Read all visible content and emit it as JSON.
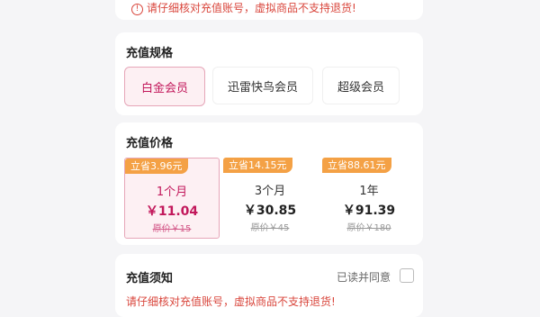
{
  "top_notice": "请仔细核对充值账号，虚拟商品不支持退货!",
  "spec": {
    "title": "充值规格",
    "options": [
      "白金会员",
      "迅雷快鸟会员",
      "超级会员"
    ],
    "selected": 0
  },
  "price": {
    "title": "充值价格",
    "plans": [
      {
        "save": "立省3.96元",
        "duration": "1个月",
        "price": "￥11.04",
        "original": "原价￥15"
      },
      {
        "save": "立省14.15元",
        "duration": "3个月",
        "price": "￥30.85",
        "original": "原价￥45"
      },
      {
        "save": "立省88.61元",
        "duration": "1年",
        "price": "￥91.39",
        "original": "原价￥180"
      }
    ],
    "selected": 0
  },
  "notice": {
    "title": "充值须知",
    "agree_label": "已读并同意",
    "warning": "请仔细核对充值账号，虚拟商品不支持退货!"
  },
  "colors": {
    "accent": "#c2185b",
    "warning": "#d9463c",
    "save_tag": "#f4a145"
  }
}
